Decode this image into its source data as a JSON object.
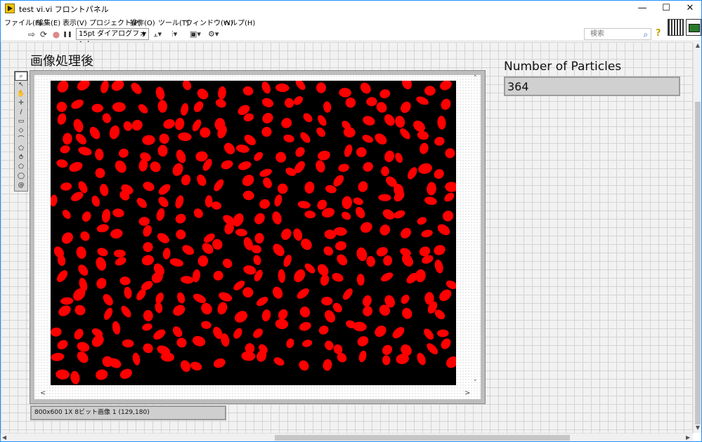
{
  "window": {
    "title": "test vi.vi フロントパネル",
    "minimize": "—",
    "maximize": "☐",
    "close": "✕"
  },
  "menu": [
    "ファイル(F)",
    "編集(E)",
    "表示(V)",
    "プロジェクト(P)",
    "操作(O)",
    "ツール(T)",
    "ウィンドウ(W)",
    "ヘルプ(H)"
  ],
  "toolbar": {
    "run_icon": "⇨",
    "run_continuous_icon": "⟳",
    "abort_icon": "●",
    "pause_icon": "❚❚",
    "font_select": "15pt ダイアログフォント",
    "align_icon": "⫠▾",
    "distribute_icon": "⫶▾",
    "resize_icon": "▣▾",
    "reorder_icon": "⚙▾",
    "search_placeholder": "検索",
    "search_icon": "⌕",
    "help_icon": "?"
  },
  "image_display": {
    "label": "画像処理後",
    "status": "800x600 1X 8ビット画像 1    (129,180)",
    "blob_color": "#ff0000",
    "background_color": "#000000",
    "tools": [
      "⌕",
      "↖",
      "✋",
      "✛",
      "∕",
      "▭",
      "◇",
      "⌒",
      "⬠",
      "⥀",
      "⬠",
      "◯",
      "@"
    ]
  },
  "particles": {
    "label": "Number of Particles",
    "value": "364"
  },
  "scroll": {
    "up": "▲",
    "down": "▼",
    "left": "◀",
    "right": "▶",
    "img_up": "˄",
    "img_down": "˅",
    "img_left": "<",
    "img_right": ">"
  }
}
